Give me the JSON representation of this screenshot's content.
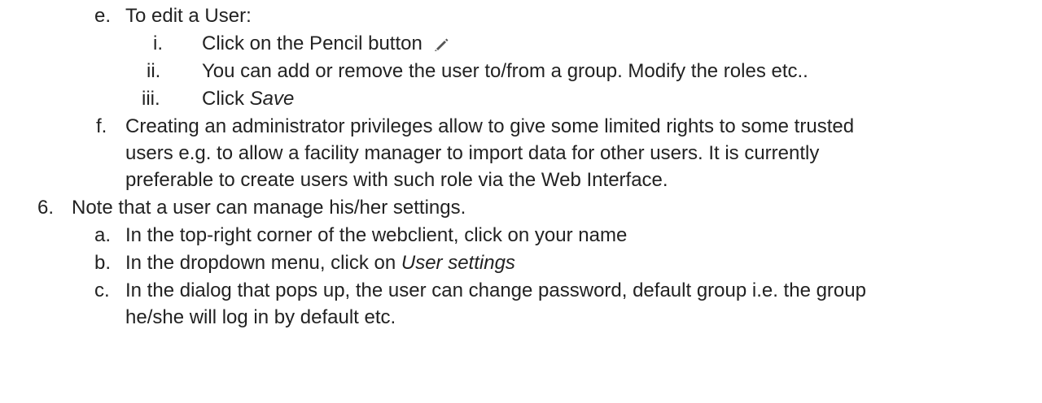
{
  "items": [
    {
      "marker": "e.",
      "text": "To edit a User:"
    },
    {
      "marker": "i.",
      "text": "Click on the Pencil button"
    },
    {
      "marker": "ii.",
      "text": "You can add or remove the user to/from a group. Modify the roles etc.."
    },
    {
      "marker": "iii.",
      "text_prefix": "Click ",
      "text_em": "Save"
    },
    {
      "marker": "f.",
      "lines": [
        "Creating an administrator privileges allow to give some limited rights to some trusted",
        "users e.g. to allow a facility manager to import data for other users. It is currently",
        "preferable to create users with such role via the Web Interface."
      ]
    },
    {
      "marker": "6.",
      "text": "Note that a user can manage his/her settings."
    },
    {
      "marker": "a.",
      "text": "In the top-right corner of the webclient, click on your name"
    },
    {
      "marker": "b.",
      "text_prefix": "In the dropdown menu, click on ",
      "text_em": "User settings"
    },
    {
      "marker": "c.",
      "lines": [
        "In the dialog that pops up, the user can change password, default group i.e. the group",
        "he/she will log in by default etc."
      ]
    }
  ],
  "icons": {
    "pencil": "pencil-icon"
  }
}
